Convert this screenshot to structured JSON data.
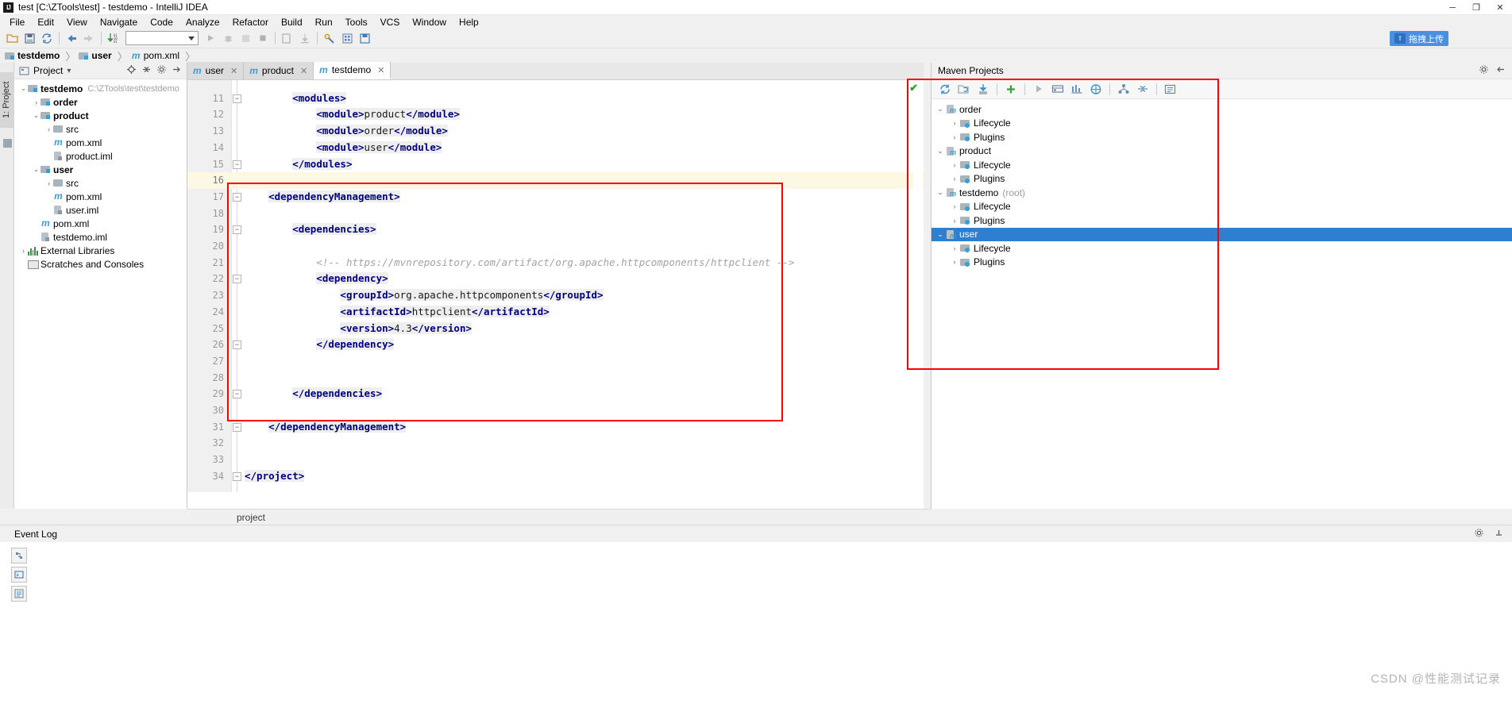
{
  "window": {
    "title": "test [C:\\ZTools\\test] - testdemo - IntelliJ IDEA",
    "app_icon": "IJ",
    "minimize": "─",
    "maximize": "❐",
    "close": "✕"
  },
  "menubar": {
    "items": [
      "File",
      "Edit",
      "View",
      "Navigate",
      "Code",
      "Analyze",
      "Refactor",
      "Build",
      "Run",
      "Tools",
      "VCS",
      "Window",
      "Help"
    ]
  },
  "toolbar": {
    "icons": [
      "open-folder-icon",
      "save-all-icon",
      "sync-icon",
      "back-arrow-icon",
      "forward-arrow-icon",
      "compile-icon"
    ],
    "run_config_placeholder": "",
    "run_icon": "▶",
    "debug_icon": "debug-bug-icon",
    "coverage_icon": "coverage-icon",
    "stop_icon": "■",
    "right_icons": [
      "update-project-icon",
      "commit-icon",
      "settings-wrench-icon",
      "structure-icon",
      "save-icon"
    ],
    "upload_pill_label": "拖拽上传"
  },
  "breadcrumb": {
    "items": [
      {
        "label": "testdemo",
        "icon": "module-icon",
        "bold": true
      },
      {
        "label": "user",
        "icon": "module-icon",
        "bold": true
      },
      {
        "label": "pom.xml",
        "icon": "maven-m-icon",
        "bold": false
      }
    ],
    "separator": "〉"
  },
  "left_strip": {
    "tab_label": "1: Project",
    "structure_icon": "structure-icon"
  },
  "project_panel": {
    "title": "Project",
    "title_caret": "▾",
    "icons": {
      "locate": "locate-icon",
      "collapse": "collapse-all-icon",
      "settings": "gear-icon",
      "hide": "hide-icon"
    },
    "tree": [
      {
        "indent": 0,
        "arrow": "⌄",
        "icon": "module-icon",
        "label": "testdemo",
        "bold": true,
        "path": "C:\\ZTools\\test\\testdemo"
      },
      {
        "indent": 1,
        "arrow": "›",
        "icon": "module-icon",
        "label": "order",
        "bold": true,
        "path": ""
      },
      {
        "indent": 1,
        "arrow": "⌄",
        "icon": "module-icon",
        "label": "product",
        "bold": true,
        "path": ""
      },
      {
        "indent": 2,
        "arrow": "›",
        "icon": "folder-icon",
        "label": "src",
        "bold": false,
        "path": ""
      },
      {
        "indent": 2,
        "arrow": "",
        "icon": "maven-m-icon",
        "label": "pom.xml",
        "bold": false,
        "path": ""
      },
      {
        "indent": 2,
        "arrow": "",
        "icon": "iml-icon",
        "label": "product.iml",
        "bold": false,
        "path": ""
      },
      {
        "indent": 1,
        "arrow": "⌄",
        "icon": "module-icon",
        "label": "user",
        "bold": true,
        "path": ""
      },
      {
        "indent": 2,
        "arrow": "›",
        "icon": "folder-icon",
        "label": "src",
        "bold": false,
        "path": ""
      },
      {
        "indent": 2,
        "arrow": "",
        "icon": "maven-m-icon",
        "label": "pom.xml",
        "bold": false,
        "path": ""
      },
      {
        "indent": 2,
        "arrow": "",
        "icon": "iml-icon",
        "label": "user.iml",
        "bold": false,
        "path": ""
      },
      {
        "indent": 1,
        "arrow": "",
        "icon": "maven-m-icon",
        "label": "pom.xml",
        "bold": false,
        "path": ""
      },
      {
        "indent": 1,
        "arrow": "",
        "icon": "iml-icon",
        "label": "testdemo.iml",
        "bold": false,
        "path": ""
      },
      {
        "indent": 0,
        "arrow": "›",
        "icon": "library-icon",
        "label": "External Libraries",
        "bold": false,
        "path": ""
      },
      {
        "indent": 0,
        "arrow": "",
        "icon": "scratches-icon",
        "label": "Scratches and Consoles",
        "bold": false,
        "path": ""
      }
    ]
  },
  "editor": {
    "tabs": [
      {
        "label": "user",
        "icon": "maven-m-icon",
        "active": false,
        "close": "✕"
      },
      {
        "label": "product",
        "icon": "maven-m-icon",
        "active": false,
        "close": "✕"
      },
      {
        "label": "testdemo",
        "icon": "maven-m-icon",
        "active": true,
        "close": "✕"
      }
    ],
    "breadcrumb_bottom": "project",
    "inspection_ok": "✔",
    "lines": [
      {
        "num": "",
        "fold": "",
        "current": false,
        "partial": true,
        "segments": []
      },
      {
        "num": "11",
        "fold": "−",
        "current": false,
        "segments": [
          {
            "t": "        ",
            "c": "txt"
          },
          {
            "t": "<modules>",
            "c": "tag"
          }
        ]
      },
      {
        "num": "12",
        "fold": "",
        "current": false,
        "segments": [
          {
            "t": "            ",
            "c": "txt"
          },
          {
            "t": "<module>",
            "c": "tag"
          },
          {
            "t": "product",
            "c": "txt"
          },
          {
            "t": "</module>",
            "c": "tag"
          }
        ]
      },
      {
        "num": "13",
        "fold": "",
        "current": false,
        "segments": [
          {
            "t": "            ",
            "c": "txt"
          },
          {
            "t": "<module>",
            "c": "tag"
          },
          {
            "t": "order",
            "c": "txt"
          },
          {
            "t": "</module>",
            "c": "tag"
          }
        ]
      },
      {
        "num": "14",
        "fold": "",
        "current": false,
        "segments": [
          {
            "t": "            ",
            "c": "txt"
          },
          {
            "t": "<module>",
            "c": "tag"
          },
          {
            "t": "user",
            "c": "txt"
          },
          {
            "t": "</module>",
            "c": "tag"
          }
        ]
      },
      {
        "num": "15",
        "fold": "−",
        "current": false,
        "segments": [
          {
            "t": "        ",
            "c": "txt"
          },
          {
            "t": "</modules>",
            "c": "tag"
          }
        ]
      },
      {
        "num": "16",
        "fold": "",
        "current": true,
        "segments": []
      },
      {
        "num": "17",
        "fold": "−",
        "current": false,
        "segments": [
          {
            "t": "    ",
            "c": "txt"
          },
          {
            "t": "<dependencyManagement>",
            "c": "tag"
          }
        ]
      },
      {
        "num": "18",
        "fold": "",
        "current": false,
        "segments": []
      },
      {
        "num": "19",
        "fold": "−",
        "current": false,
        "segments": [
          {
            "t": "        ",
            "c": "txt"
          },
          {
            "t": "<dependencies>",
            "c": "tag"
          }
        ]
      },
      {
        "num": "20",
        "fold": "",
        "current": false,
        "segments": []
      },
      {
        "num": "21",
        "fold": "",
        "current": false,
        "segments": [
          {
            "t": "            ",
            "c": "txt"
          },
          {
            "t": "<!-- https://mvnrepository.com/artifact/org.apache.httpcomponents/httpclient -->",
            "c": "cmt"
          }
        ]
      },
      {
        "num": "22",
        "fold": "−",
        "current": false,
        "segments": [
          {
            "t": "            ",
            "c": "txt"
          },
          {
            "t": "<dependency>",
            "c": "tag"
          }
        ]
      },
      {
        "num": "23",
        "fold": "",
        "current": false,
        "segments": [
          {
            "t": "                ",
            "c": "txt"
          },
          {
            "t": "<groupId>",
            "c": "tag"
          },
          {
            "t": "org.apache.httpcomponents",
            "c": "txt"
          },
          {
            "t": "</groupId>",
            "c": "tag"
          }
        ]
      },
      {
        "num": "24",
        "fold": "",
        "current": false,
        "segments": [
          {
            "t": "                ",
            "c": "txt"
          },
          {
            "t": "<artifactId>",
            "c": "tag"
          },
          {
            "t": "httpclient",
            "c": "txt"
          },
          {
            "t": "</artifactId>",
            "c": "tag"
          }
        ]
      },
      {
        "num": "25",
        "fold": "",
        "current": false,
        "segments": [
          {
            "t": "                ",
            "c": "txt"
          },
          {
            "t": "<version>",
            "c": "tag"
          },
          {
            "t": "4.3",
            "c": "txt"
          },
          {
            "t": "</version>",
            "c": "tag"
          }
        ]
      },
      {
        "num": "26",
        "fold": "−",
        "current": false,
        "segments": [
          {
            "t": "            ",
            "c": "txt"
          },
          {
            "t": "</dependency>",
            "c": "tag"
          }
        ]
      },
      {
        "num": "27",
        "fold": "",
        "current": false,
        "segments": []
      },
      {
        "num": "28",
        "fold": "",
        "current": false,
        "segments": []
      },
      {
        "num": "29",
        "fold": "−",
        "current": false,
        "segments": [
          {
            "t": "        ",
            "c": "txt"
          },
          {
            "t": "</dependencies>",
            "c": "tag"
          }
        ]
      },
      {
        "num": "30",
        "fold": "",
        "current": false,
        "segments": []
      },
      {
        "num": "31",
        "fold": "−",
        "current": false,
        "segments": [
          {
            "t": "    ",
            "c": "txt"
          },
          {
            "t": "</dependencyManagement>",
            "c": "tag"
          }
        ]
      },
      {
        "num": "32",
        "fold": "",
        "current": false,
        "segments": []
      },
      {
        "num": "33",
        "fold": "",
        "current": false,
        "segments": []
      },
      {
        "num": "34",
        "fold": "−",
        "current": false,
        "segments": [
          {
            "t": "",
            "c": "txt"
          },
          {
            "t": "</project>",
            "c": "tag"
          }
        ]
      }
    ]
  },
  "maven_panel": {
    "title": "Maven Projects",
    "header_icons": [
      "gear-icon",
      "hide-icon"
    ],
    "toolbar_icons": [
      "reimport-icon",
      "generate-sources-icon",
      "download-sources-icon",
      "add-maven-project-icon",
      "run-icon",
      "toggle-offline-icon",
      "skip-tests-icon",
      "execute-goal-icon",
      "show-dependencies-icon",
      "collapse-all-icon",
      "settings-icon"
    ],
    "tree": [
      {
        "indent": 0,
        "arrow": "⌄",
        "icon": "maven-project-icon",
        "label": "order",
        "suffix": "",
        "selected": false
      },
      {
        "indent": 1,
        "arrow": "›",
        "icon": "phase-folder-icon",
        "label": "Lifecycle",
        "suffix": "",
        "selected": false
      },
      {
        "indent": 1,
        "arrow": "›",
        "icon": "phase-folder-icon",
        "label": "Plugins",
        "suffix": "",
        "selected": false
      },
      {
        "indent": 0,
        "arrow": "⌄",
        "icon": "maven-project-icon",
        "label": "product",
        "suffix": "",
        "selected": false
      },
      {
        "indent": 1,
        "arrow": "›",
        "icon": "phase-folder-icon",
        "label": "Lifecycle",
        "suffix": "",
        "selected": false
      },
      {
        "indent": 1,
        "arrow": "›",
        "icon": "phase-folder-icon",
        "label": "Plugins",
        "suffix": "",
        "selected": false
      },
      {
        "indent": 0,
        "arrow": "⌄",
        "icon": "maven-project-icon",
        "label": "testdemo",
        "suffix": "(root)",
        "selected": false
      },
      {
        "indent": 1,
        "arrow": "›",
        "icon": "phase-folder-icon",
        "label": "Lifecycle",
        "suffix": "",
        "selected": false
      },
      {
        "indent": 1,
        "arrow": "›",
        "icon": "phase-folder-icon",
        "label": "Plugins",
        "suffix": "",
        "selected": false
      },
      {
        "indent": 0,
        "arrow": "⌄",
        "icon": "maven-project-icon",
        "label": "user",
        "suffix": "",
        "selected": true
      },
      {
        "indent": 1,
        "arrow": "›",
        "icon": "phase-folder-icon",
        "label": "Lifecycle",
        "suffix": "",
        "selected": false
      },
      {
        "indent": 1,
        "arrow": "›",
        "icon": "phase-folder-icon",
        "label": "Plugins",
        "suffix": "",
        "selected": false
      }
    ]
  },
  "statusbar": {
    "event_log": "Event Log",
    "right_icons": [
      "gear-icon",
      "hide-icon"
    ]
  },
  "watermark": "CSDN @性能测试记录",
  "colors": {
    "accent": "#2f7fd1",
    "annotation_red": "#ff0000",
    "tag_blue": "#000080",
    "comment_gray": "#a3a3a3",
    "current_line": "#fdf8e3",
    "maven_icon_blue": "#389fd6"
  }
}
